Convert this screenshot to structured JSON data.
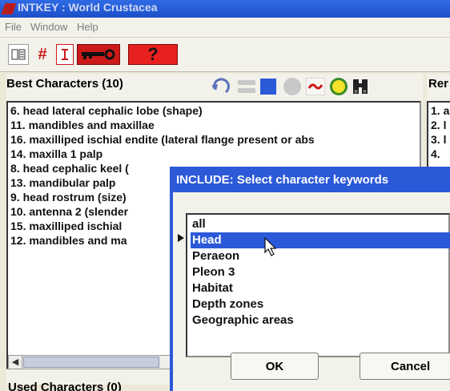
{
  "window": {
    "title": "INTKEY : World Crustacea"
  },
  "menu": {
    "file": "File",
    "window": "Window",
    "help": "Help"
  },
  "toolbar": {
    "hash": "#",
    "question": "?"
  },
  "best_characters": {
    "title": "Best Characters (10)",
    "items": [
      "6. head lateral cephalic lobe (shape)",
      "11. mandibles and maxillae",
      "16. maxilliped ischial endite (lateral flange present or abs",
      "14. maxilla 1 palp",
      "8. head cephalic keel (",
      "13. mandibular palp",
      "9. head rostrum (size)",
      "10. antenna 2 (slender",
      "15. maxilliped ischial",
      "12. mandibles and ma"
    ]
  },
  "remaining": {
    "title": "Rer",
    "items": [
      "1. a",
      "2. l",
      "3. l",
      "4. "
    ]
  },
  "bottom_panel": {
    "title": "Used Characters (0)"
  },
  "dialog": {
    "title": "INCLUDE: Select character keywords",
    "keywords": [
      "all",
      "Head",
      "Peraeon",
      "Pleon 3",
      "Habitat",
      "Depth zones",
      "Geographic areas"
    ],
    "selected_index": 1,
    "ok_label": "OK",
    "cancel_label": "Cancel"
  },
  "colors": {
    "selection": "#2b59d8",
    "key_icon": "#cc1a1a",
    "question_bg": "#e82020"
  }
}
